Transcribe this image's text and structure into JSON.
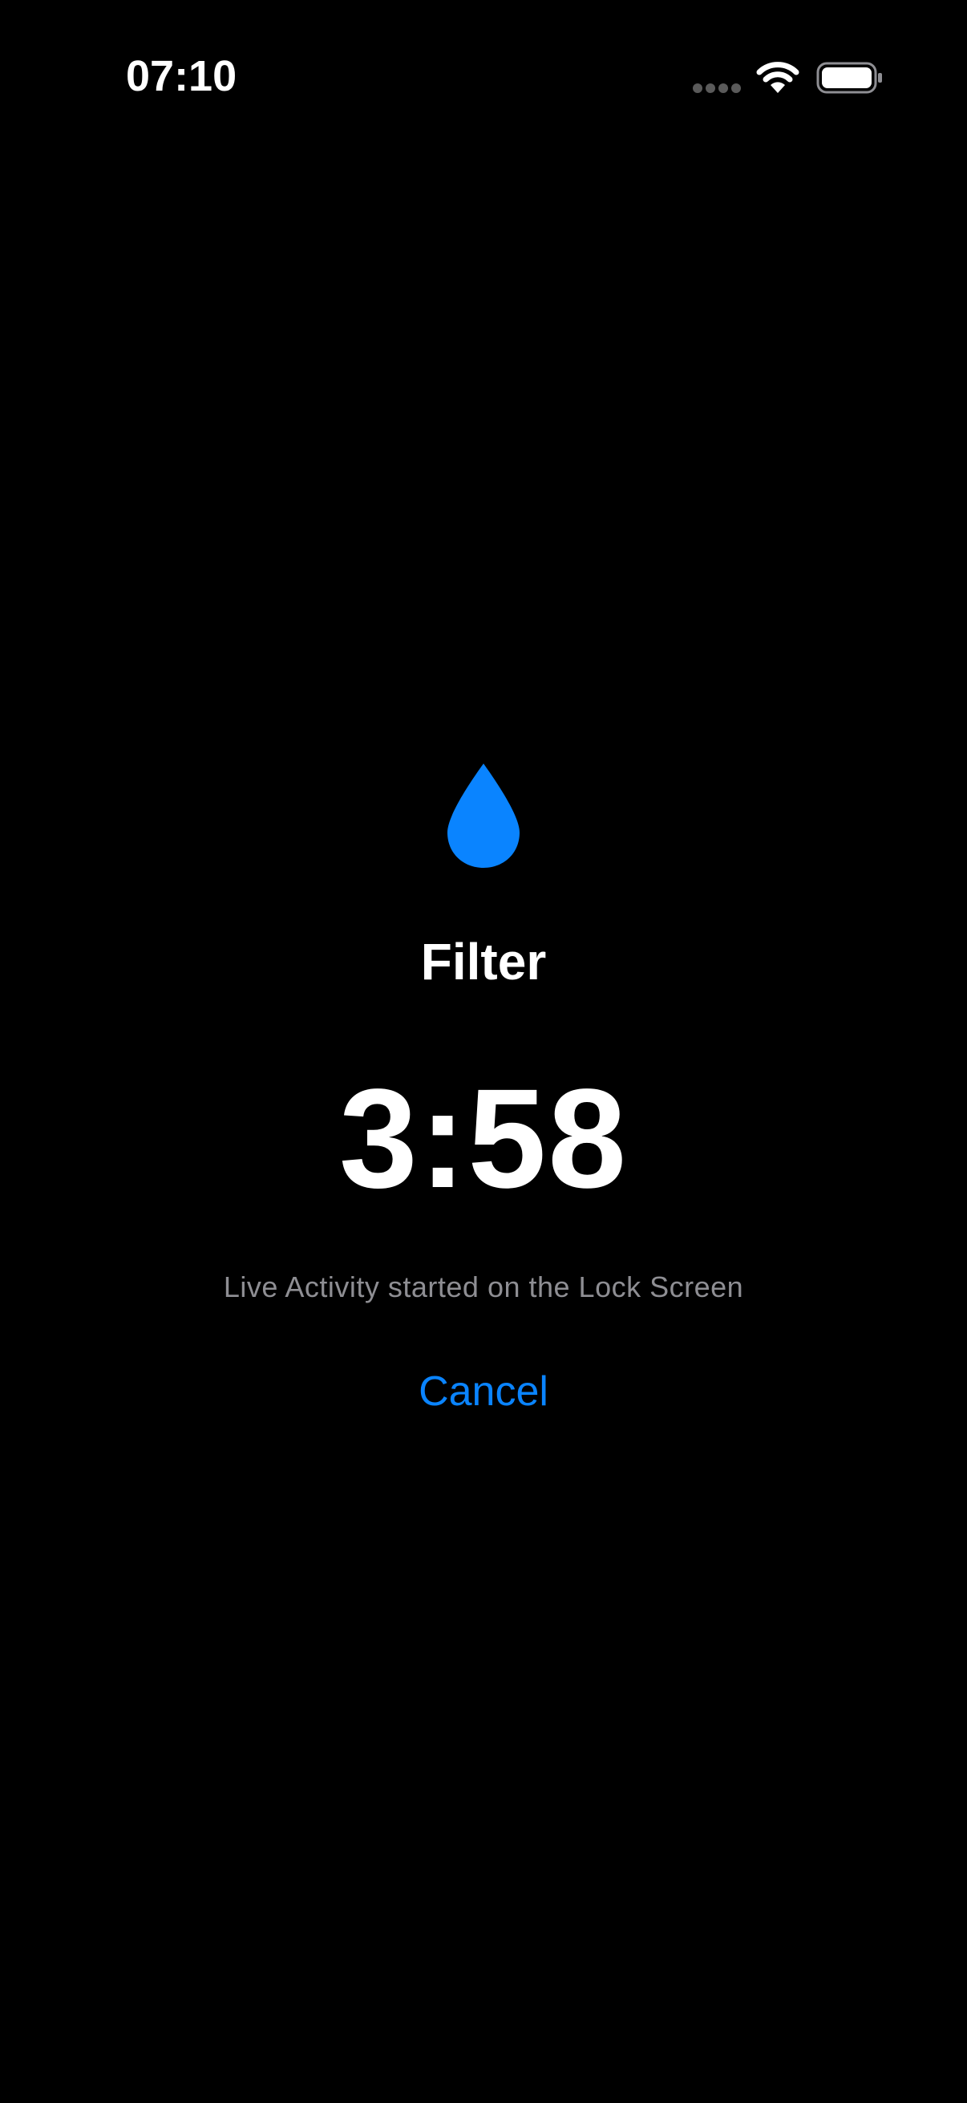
{
  "status_bar": {
    "time": "07:10",
    "wifi_icon": "wifi-icon",
    "battery_icon": "battery-icon"
  },
  "main": {
    "icon": "water-drop-icon",
    "icon_color": "#0A84FF",
    "title": "Filter",
    "timer": "3:58",
    "subtitle": "Live Activity started on the Lock Screen",
    "cancel_label": "Cancel",
    "accent_color": "#0A84FF"
  }
}
